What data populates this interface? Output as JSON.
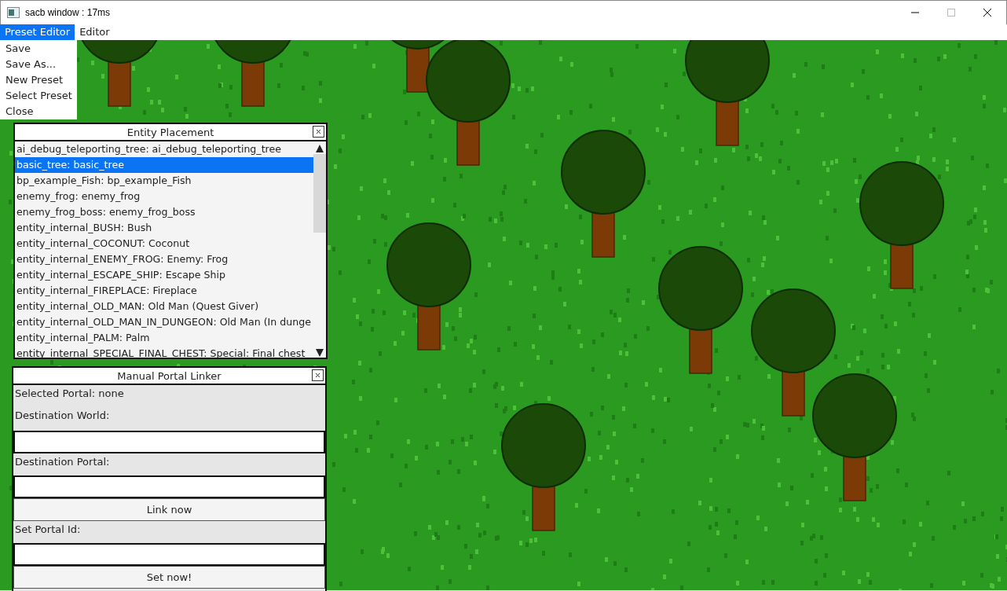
{
  "window": {
    "title": "sacb window : 17ms"
  },
  "menu_bar": [
    {
      "label": "Preset Editor",
      "selected": true
    },
    {
      "label": "Editor",
      "selected": false
    }
  ],
  "dropdown": [
    "Save",
    "Save As...",
    "New Preset",
    "Select Preset",
    "Close"
  ],
  "entity_placement": {
    "title": "Entity Placement",
    "items": [
      {
        "label": "ai_debug_teleporting_tree: ai_debug_teleporting_tree",
        "selected": false
      },
      {
        "label": "basic_tree: basic_tree",
        "selected": true
      },
      {
        "label": "bp_example_Fish: bp_example_Fish",
        "selected": false
      },
      {
        "label": "enemy_frog: enemy_frog",
        "selected": false
      },
      {
        "label": "enemy_frog_boss: enemy_frog_boss",
        "selected": false
      },
      {
        "label": "entity_internal_BUSH: Bush",
        "selected": false
      },
      {
        "label": "entity_internal_COCONUT: Coconut",
        "selected": false
      },
      {
        "label": "entity_internal_ENEMY_FROG: Enemy: Frog",
        "selected": false
      },
      {
        "label": "entity_internal_ESCAPE_SHIP: Escape Ship",
        "selected": false
      },
      {
        "label": "entity_internal_FIREPLACE: Fireplace",
        "selected": false
      },
      {
        "label": "entity_internal_OLD_MAN: Old Man (Quest Giver)",
        "selected": false
      },
      {
        "label": "entity_internal_OLD_MAN_IN_DUNGEON: Old Man (In dunge",
        "selected": false
      },
      {
        "label": "entity_internal_PALM: Palm",
        "selected": false
      },
      {
        "label": "entity_internal_SPECIAL_FINAL_CHEST: Special: Final chest",
        "selected": false
      }
    ]
  },
  "portal_linker": {
    "title": "Manual Portal Linker",
    "rows": [
      {
        "kind": "label",
        "text": "Selected Portal: none"
      },
      {
        "kind": "label",
        "text": "Destination World:"
      },
      {
        "kind": "input"
      },
      {
        "kind": "label",
        "text": "Destination Portal:"
      },
      {
        "kind": "input"
      },
      {
        "kind": "button",
        "text": "Link now"
      },
      {
        "kind": "label",
        "text": "Set Portal Id:"
      },
      {
        "kind": "input"
      },
      {
        "kind": "button",
        "text": "Set now!"
      }
    ]
  }
}
